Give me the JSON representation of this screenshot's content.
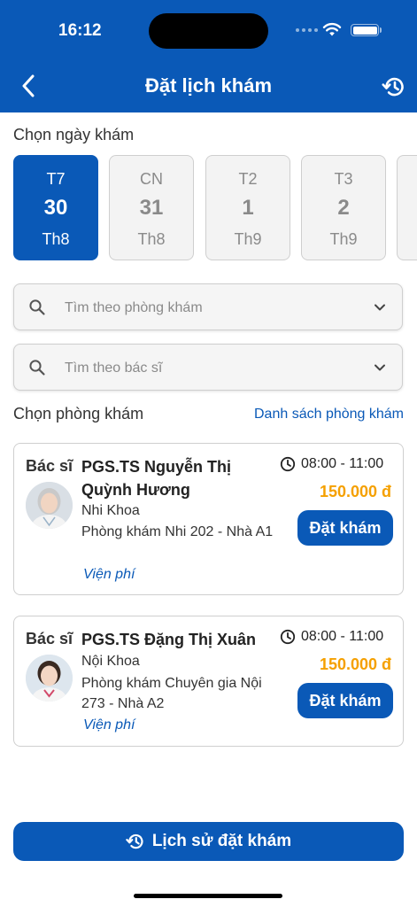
{
  "status_bar": {
    "time": "16:12"
  },
  "nav": {
    "title": "Đặt lịch khám",
    "back_icon": "chevron-left-icon",
    "history_icon": "history-icon"
  },
  "date_section": {
    "label": "Chọn ngày khám",
    "dates": [
      {
        "dow": "T7",
        "day": "30",
        "month": "Th8",
        "selected": true
      },
      {
        "dow": "CN",
        "day": "31",
        "month": "Th8",
        "selected": false
      },
      {
        "dow": "T2",
        "day": "1",
        "month": "Th9",
        "selected": false
      },
      {
        "dow": "T3",
        "day": "2",
        "month": "Th9",
        "selected": false
      }
    ]
  },
  "search": {
    "clinic_placeholder": "Tìm theo phòng khám",
    "doctor_placeholder": "Tìm theo bác sĩ"
  },
  "clinic_section": {
    "label": "Chọn phòng khám",
    "list_link": "Danh sách phòng khám"
  },
  "doctors": [
    {
      "role": "Bác sĩ",
      "name": "PGS.TS Nguyễn Thị Quỳnh Hương",
      "dept": "Nhi Khoa",
      "room": "Phòng khám Nhi 202 - Nhà A1",
      "fee_label": "Viện phí",
      "time": "08:00 - 11:00",
      "price": "150.000 đ",
      "book_label": "Đặt khám"
    },
    {
      "role": "Bác sĩ",
      "name": "PGS.TS Đặng Thị Xuân",
      "dept": "Nội Khoa",
      "room": "Phòng khám Chuyên gia Nội 273 - Nhà A2",
      "fee_label": "Viện phí",
      "time": "08:00 - 11:00",
      "price": "150.000 đ",
      "book_label": "Đặt khám"
    }
  ],
  "footer": {
    "history_button": "Lịch sử đặt khám"
  },
  "colors": {
    "primary": "#0a59b7",
    "price": "#f5a000",
    "muted": "#8a8a8a"
  }
}
